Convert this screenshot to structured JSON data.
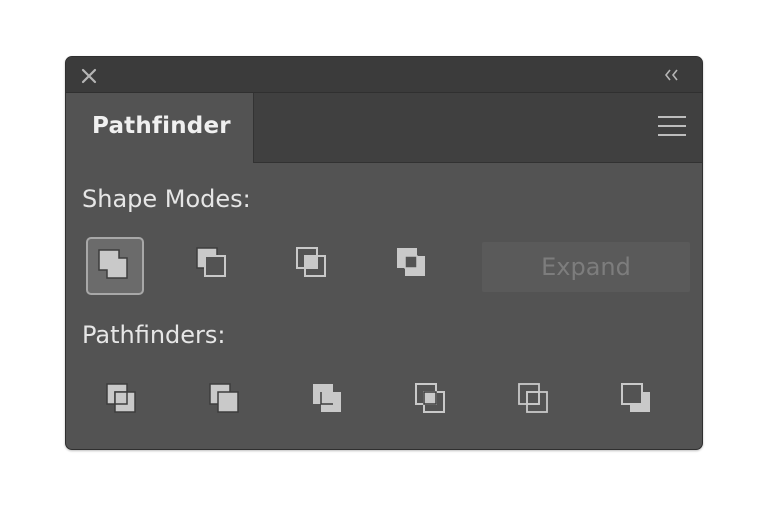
{
  "colors": {
    "panel_bg": "#535353",
    "titlebar_bg": "#3b3b3b",
    "icon_fill": "#c9c9c9",
    "text": "#e6e6e6",
    "disabled_text": "#7d7d7d"
  },
  "titlebar": {
    "close_icon": "close-icon",
    "collapse_icon": "double-chevron-left-icon"
  },
  "tab": {
    "label": "Pathfinder",
    "menu_icon": "hamburger-menu-icon"
  },
  "shape_modes": {
    "label": "Shape Modes:",
    "buttons": [
      "unite-icon",
      "minus-front-icon",
      "intersect-icon",
      "exclude-icon"
    ],
    "selected": "unite-icon",
    "expand_label": "Expand",
    "expand_enabled": false
  },
  "pathfinders": {
    "label": "Pathfinders:",
    "buttons": [
      "divide-icon",
      "trim-icon",
      "merge-icon",
      "crop-icon",
      "outline-icon",
      "minus-back-icon"
    ]
  }
}
